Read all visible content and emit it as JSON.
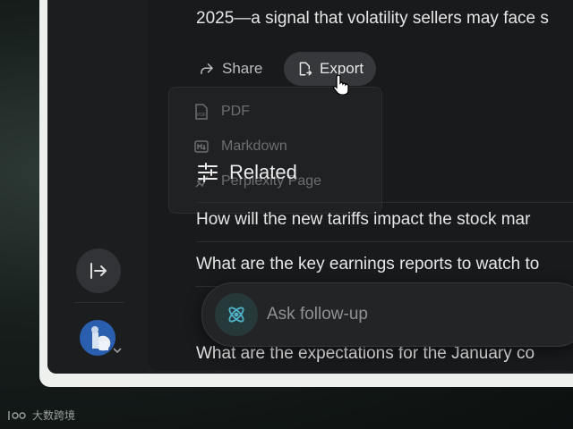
{
  "answer": {
    "top_line": "2025—a signal that volatility sellers may face s"
  },
  "actions": {
    "share_label": "Share",
    "export_label": "Export"
  },
  "export_menu": {
    "items": [
      {
        "label": "PDF",
        "icon": "pdf-file-icon"
      },
      {
        "label": "Markdown",
        "icon": "markdown-icon"
      },
      {
        "label": "Perplexity Page",
        "icon": "perplexity-page-icon"
      }
    ]
  },
  "related": {
    "heading": "Related",
    "questions": [
      "How will the new tariffs impact the stock mar",
      "What are the key earnings reports to watch to",
      "What are the expectations for the January co"
    ]
  },
  "followup": {
    "placeholder": "Ask follow-up"
  },
  "watermark": {
    "text": "大数跨境"
  },
  "colors": {
    "accent": "#4fb3c9",
    "background": "#191a1c"
  }
}
